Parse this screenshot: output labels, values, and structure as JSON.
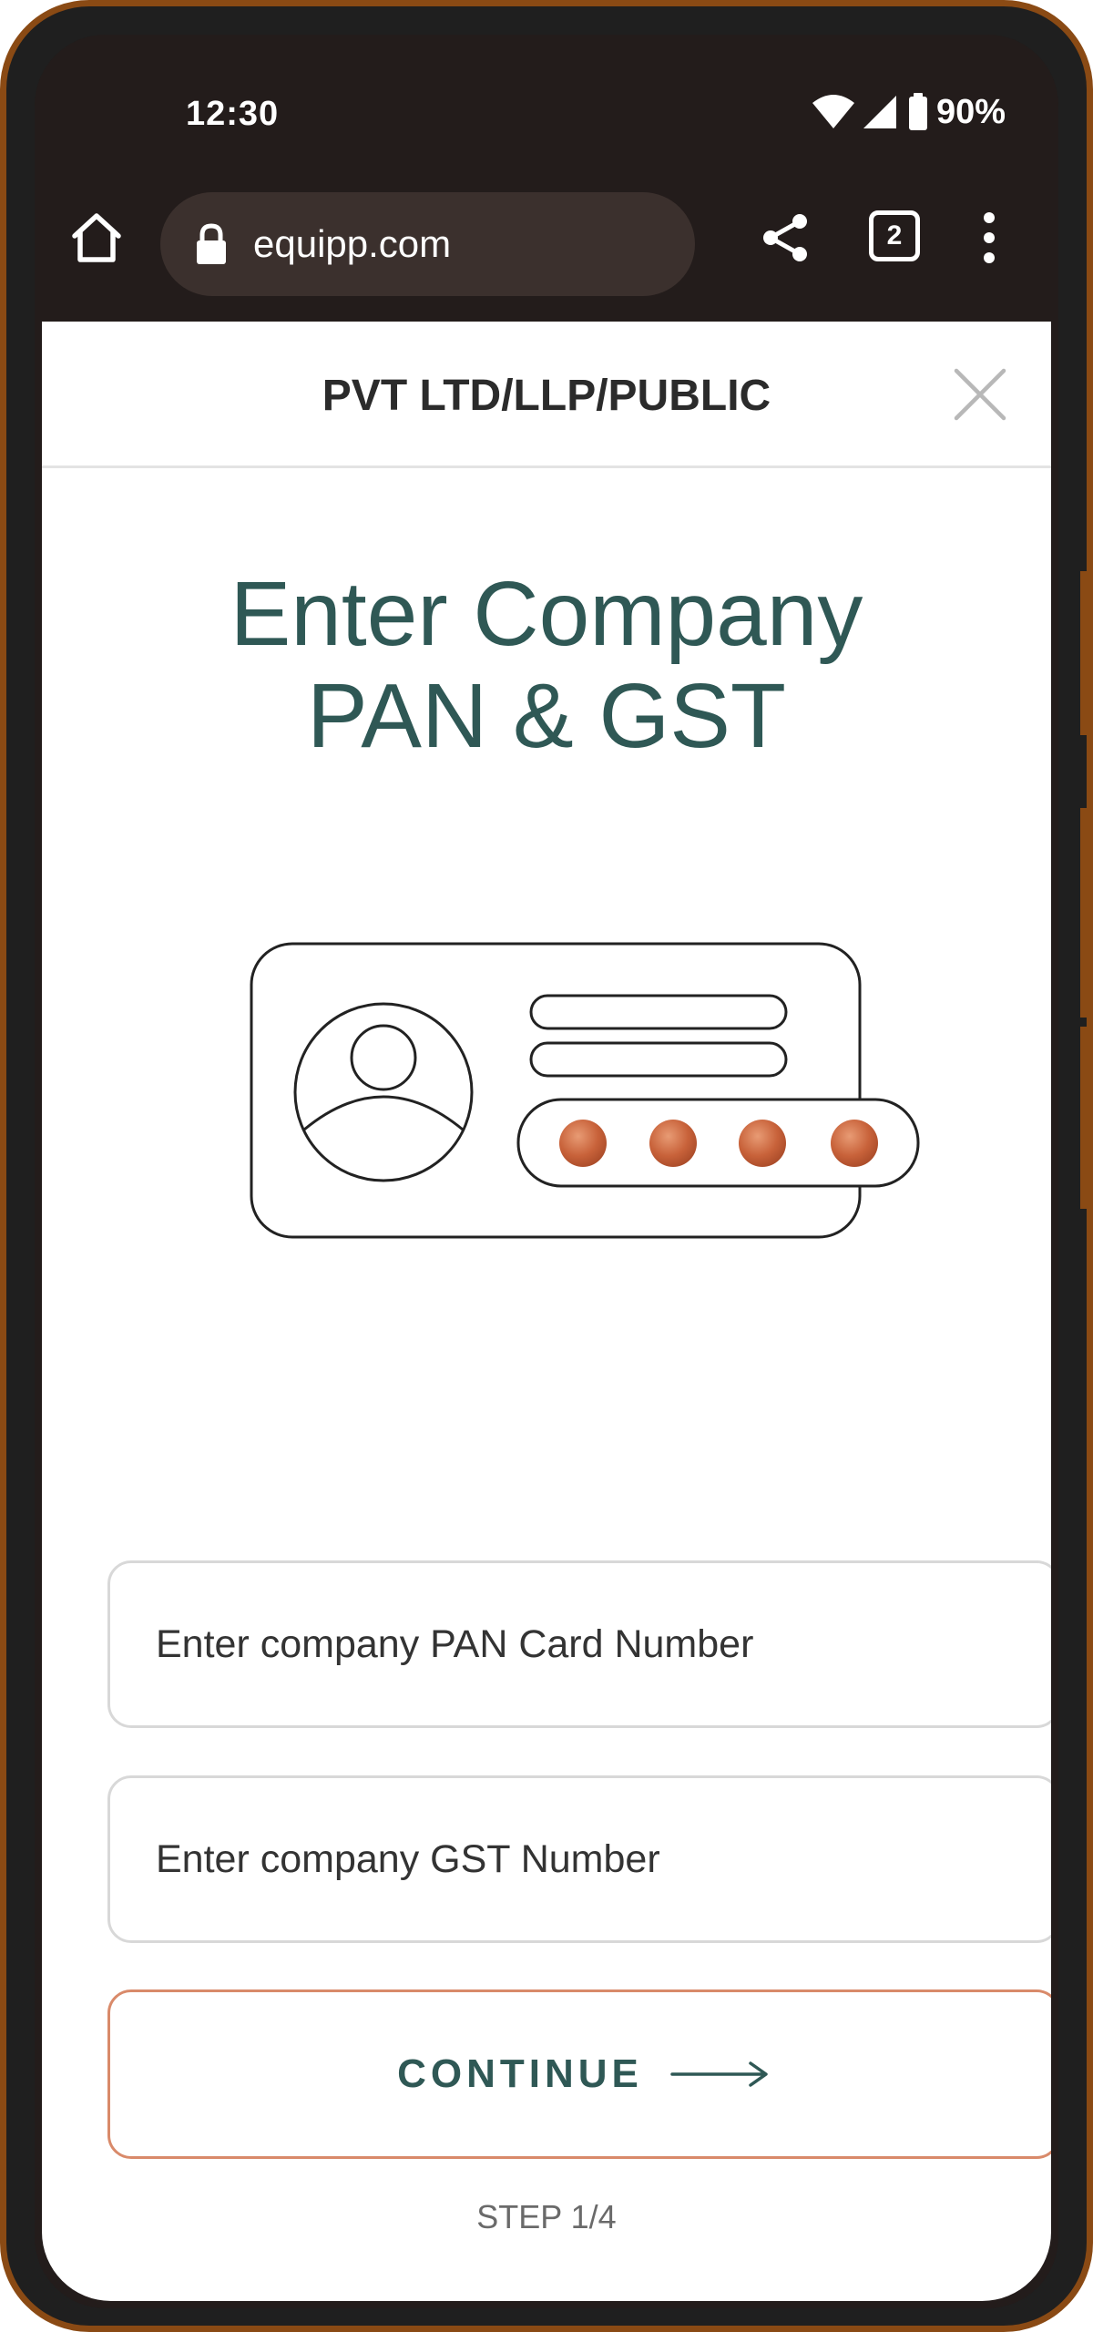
{
  "status_bar": {
    "time": "12:30",
    "battery": "90%",
    "icons": [
      "wifi-icon",
      "signal-icon",
      "battery-icon"
    ]
  },
  "browser": {
    "url": "equipp.com",
    "tab_count": "2",
    "icons": [
      "home-icon",
      "lock-icon",
      "share-icon",
      "tabs-icon",
      "more-vert-icon"
    ]
  },
  "header": {
    "title": "PVT LTD/LLP/PUBLIC",
    "close_icon": "close-icon"
  },
  "main": {
    "title_line1": "Enter Company",
    "title_line2": "PAN & GST",
    "illustration": "id-card-illustration",
    "pan_placeholder": "Enter company PAN Card Number",
    "gst_placeholder": "Enter company GST Number",
    "continue_label": "CONTINUE",
    "step_label": "STEP 1/4"
  },
  "colors": {
    "brand_teal": "#2f5855",
    "accent_copper": "#c8623a",
    "browser_bg": "#231c1b",
    "url_pill": "#3b302d"
  }
}
